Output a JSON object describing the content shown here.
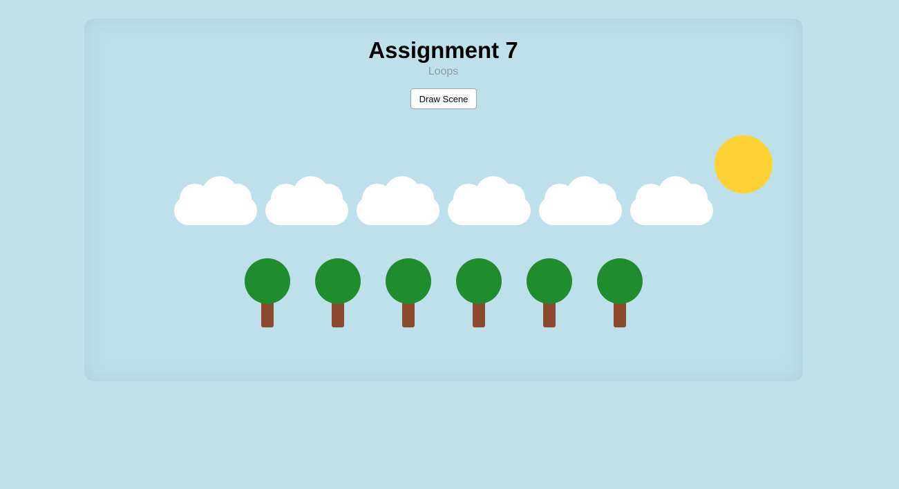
{
  "header": {
    "title": "Assignment 7",
    "subtitle": "Loops"
  },
  "controls": {
    "draw_button_label": "Draw Scene"
  },
  "scene": {
    "cloud_count": 6,
    "tree_count": 6,
    "colors": {
      "sky": "#c0e0ea",
      "sun": "#ffd233",
      "cloud": "#ffffff",
      "tree_crown": "#1f8d2e",
      "tree_trunk": "#8b4a2d"
    }
  }
}
